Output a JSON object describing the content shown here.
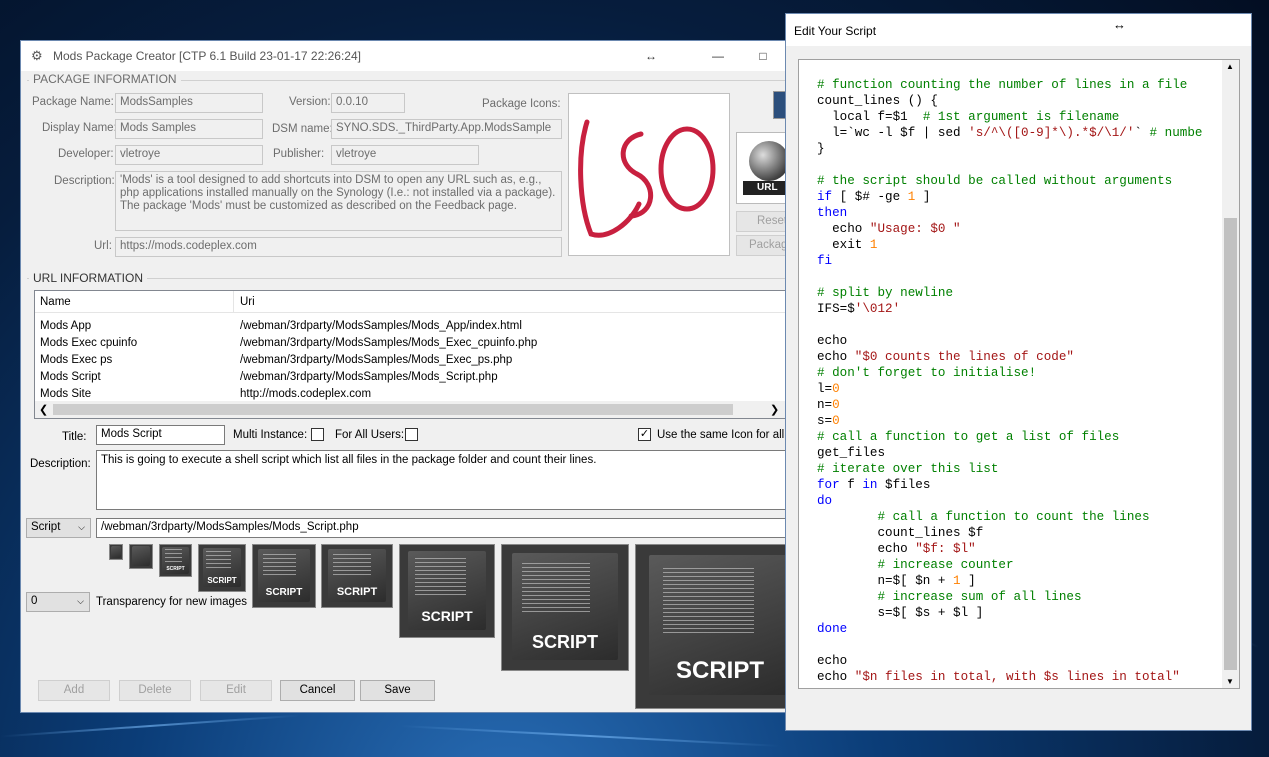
{
  "main": {
    "title": "Mods Package Creator [CTP 6.1 Build 23-01-17 22:26:24]",
    "pkg_group": "PACKAGE INFORMATION",
    "package_name_label": "Package Name:",
    "package_name": "ModsSamples",
    "version_label": "Version:",
    "version": "0.0.10",
    "icons_label": "Package Icons:",
    "display_name_label": "Display Name:",
    "display_name": "Mods Samples",
    "dsm_label": "DSM name:",
    "dsm_name": "SYNO.SDS._ThirdParty.App.ModsSample",
    "developer_label": "Developer:",
    "developer": "vletroye",
    "publisher_label": "Publisher:",
    "publisher": "vletroye",
    "description_label": "Description:",
    "description": "'Mods' is a tool designed to add shortcuts into DSM to open any URL such as, e.g., php applications installed manually on the Synology (I.e.: not installed via a package). The package 'Mods' must be customized as described on the Feedback page.",
    "url_label": "Url:",
    "url": "https://mods.codeplex.com",
    "reset_label": "Reset",
    "package_label": "Package",
    "url_badge": "URL",
    "url_group": "URL INFORMATION",
    "col_name": "Name",
    "col_uri": "Uri",
    "rows": [
      {
        "name": "Mods App",
        "uri": "/webman/3rdparty/ModsSamples/Mods_App/index.html"
      },
      {
        "name": "Mods Exec cpuinfo",
        "uri": "/webman/3rdparty/ModsSamples/Mods_Exec_cpuinfo.php"
      },
      {
        "name": "Mods Exec ps",
        "uri": "/webman/3rdparty/ModsSamples/Mods_Exec_ps.php"
      },
      {
        "name": "Mods Script",
        "uri": "/webman/3rdparty/ModsSamples/Mods_Script.php"
      },
      {
        "name": "Mods Site",
        "uri": "http://mods.codeplex.com"
      }
    ],
    "title_label": "Title:",
    "item_title": "Mods Script",
    "multi_label": "Multi Instance:",
    "all_users_label": "For All Users:",
    "same_icon_label": "Use the same Icon for all siz",
    "desc2_label": "Description:",
    "desc2": "This is going to execute a shell script which list all files in the package folder and count their lines.",
    "type_select": "Script",
    "script_path": "/webman/3rdparty/ModsSamples/Mods_Script.php",
    "thumb_caption": "SCRIPT",
    "transparency_select": "0",
    "transparency_label": "Transparency for new images",
    "add": "Add",
    "delete": "Delete",
    "edit": "Edit",
    "cancel": "Cancel",
    "save": "Save"
  },
  "editor": {
    "title": "Edit Your Script",
    "code": [
      [
        [
          "c",
          "# function counting the number of lines in a file"
        ]
      ],
      [
        [
          "p",
          "count_lines () {"
        ]
      ],
      [
        [
          "p",
          "  local f="
        ],
        [
          "p",
          "$1  "
        ],
        [
          "c",
          "# 1st argument is filename"
        ]
      ],
      [
        [
          "p",
          "  l=`wc -l $f | sed "
        ],
        [
          "s",
          "'s/^\\([0-9]*\\).*$/\\1/'"
        ],
        [
          "p",
          "` "
        ],
        [
          "c",
          "# numbe"
        ]
      ],
      [
        [
          "p",
          "}"
        ]
      ],
      [
        [
          "p",
          ""
        ]
      ],
      [
        [
          "c",
          "# the script should be called without arguments"
        ]
      ],
      [
        [
          "k",
          "if"
        ],
        [
          "p",
          " [ $# -ge "
        ],
        [
          "n",
          "1"
        ],
        [
          "p",
          " ]"
        ]
      ],
      [
        [
          "k",
          "then"
        ]
      ],
      [
        [
          "p",
          "  echo "
        ],
        [
          "s",
          "\"Usage: $0 \""
        ]
      ],
      [
        [
          "p",
          "  exit "
        ],
        [
          "n",
          "1"
        ]
      ],
      [
        [
          "k",
          "fi"
        ]
      ],
      [
        [
          "p",
          ""
        ]
      ],
      [
        [
          "c",
          "# split by newline"
        ]
      ],
      [
        [
          "p",
          "IFS=$"
        ],
        [
          "s",
          "'\\012'"
        ]
      ],
      [
        [
          "p",
          ""
        ]
      ],
      [
        [
          "p",
          "echo"
        ]
      ],
      [
        [
          "p",
          "echo "
        ],
        [
          "s",
          "\"$0 counts the lines of code\""
        ]
      ],
      [
        [
          "c",
          "# don't forget to initialise!"
        ]
      ],
      [
        [
          "p",
          "l="
        ],
        [
          "n",
          "0"
        ]
      ],
      [
        [
          "p",
          "n="
        ],
        [
          "n",
          "0"
        ]
      ],
      [
        [
          "p",
          "s="
        ],
        [
          "n",
          "0"
        ]
      ],
      [
        [
          "c",
          "# call a function to get a list of files"
        ]
      ],
      [
        [
          "p",
          "get_files"
        ]
      ],
      [
        [
          "c",
          "# iterate over this list"
        ]
      ],
      [
        [
          "k",
          "for"
        ],
        [
          "p",
          " f "
        ],
        [
          "k",
          "in"
        ],
        [
          "p",
          " $files"
        ]
      ],
      [
        [
          "k",
          "do"
        ]
      ],
      [
        [
          "p",
          "        "
        ],
        [
          "c",
          "# call a function to count the lines"
        ]
      ],
      [
        [
          "p",
          "        count_lines $f"
        ]
      ],
      [
        [
          "p",
          "        echo "
        ],
        [
          "s",
          "\"$f: $l\""
        ]
      ],
      [
        [
          "p",
          "        "
        ],
        [
          "c",
          "# increase counter"
        ]
      ],
      [
        [
          "p",
          "        n=$[ $n + "
        ],
        [
          "n",
          "1"
        ],
        [
          "p",
          " ]"
        ]
      ],
      [
        [
          "p",
          "        "
        ],
        [
          "c",
          "# increase sum of all lines"
        ]
      ],
      [
        [
          "p",
          "        s=$[ $s + $l ]"
        ]
      ],
      [
        [
          "k",
          "done"
        ]
      ],
      [
        [
          "p",
          ""
        ]
      ],
      [
        [
          "p",
          "echo"
        ]
      ],
      [
        [
          "p",
          "echo "
        ],
        [
          "s",
          "\"$n files in total, with $s lines in total\""
        ]
      ]
    ]
  }
}
